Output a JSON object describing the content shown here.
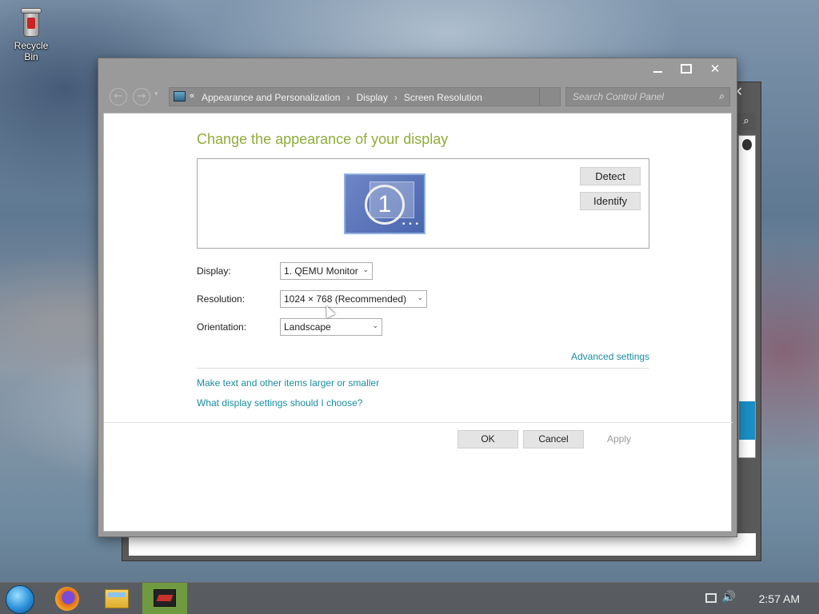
{
  "desktop": {
    "icons": [
      {
        "label": "Recycle Bin",
        "icon": "recycle-bin-icon"
      }
    ]
  },
  "window": {
    "controls": {
      "minimize": "minimize",
      "maximize": "maximize",
      "close": "✕"
    },
    "nav": {
      "back": "←",
      "forward": "→",
      "recent": "▾"
    },
    "breadcrumb": {
      "overflow": "«",
      "items": [
        "Appearance and Personalization",
        "Display",
        "Screen Resolution"
      ],
      "separator": "›"
    },
    "search": {
      "placeholder": "Search Control Panel"
    }
  },
  "main": {
    "title": "Change the appearance of your display",
    "preview": {
      "monitor_number": "1",
      "detect_label": "Detect",
      "identify_label": "Identify"
    },
    "fields": {
      "display": {
        "label": "Display:",
        "value": "1. QEMU Monitor"
      },
      "resolution": {
        "label": "Resolution:",
        "value": "1024 × 768 (Recommended)"
      },
      "orientation": {
        "label": "Orientation:",
        "value": "Landscape"
      }
    },
    "advanced_link": "Advanced settings",
    "links": [
      "Make text and other items larger or smaller",
      "What display settings should I choose?"
    ],
    "buttons": {
      "ok": "OK",
      "cancel": "Cancel",
      "apply": "Apply"
    }
  },
  "taskbar": {
    "pinned": [
      "firefox-icon",
      "file-explorer-icon",
      "control-panel-icon"
    ],
    "active": "control-panel-icon",
    "clock": "2:57 AM"
  },
  "colors": {
    "title_green": "#8fac39",
    "link_teal": "#1b8ca0",
    "active_task": "#6f9a3f"
  }
}
